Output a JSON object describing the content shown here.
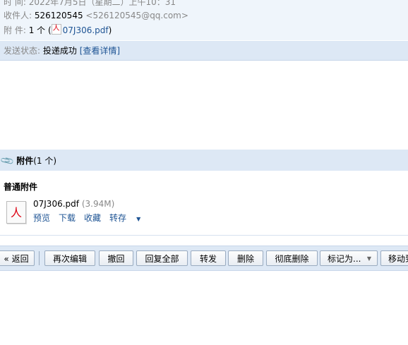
{
  "meta": {
    "time_label": "时   间:",
    "time_value": "2022年7月5日（星期二）上午10：31",
    "to_label": "收件人:",
    "to_name": "526120545",
    "to_email": "<526120545@qq.com>",
    "attach_label": "附   件:",
    "attach_count": "1 个 (",
    "attach_file": "07J306.pdf",
    "attach_close": ")"
  },
  "status": {
    "label": "发送状态:",
    "value": "投递成功",
    "detail_link": "[查看详情]"
  },
  "attachments": {
    "header_title": "附件",
    "header_count": "(1 个)",
    "section_title": "普通附件",
    "file_name": "07J306.pdf",
    "file_size": "(3.94M)",
    "actions": [
      "预览",
      "下载",
      "收藏",
      "转存"
    ]
  },
  "toolbar": {
    "back": "« 返回",
    "buttons": [
      "再次编辑",
      "撤回",
      "回复全部",
      "转发",
      "删除",
      "彻底删除",
      "标记为...",
      "移动到"
    ]
  },
  "colors": {
    "link": "#1e5494",
    "bar": "#dde8f5",
    "header_bg": "#eff5fb"
  }
}
